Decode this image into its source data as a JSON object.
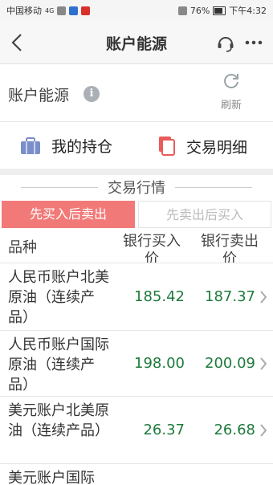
{
  "status_bar": {
    "carrier": "中国移动",
    "signal": "4G",
    "battery": "76%",
    "time": "下午4:32"
  },
  "header": {
    "title": "账户能源"
  },
  "account": {
    "label": "账户能源",
    "info_icon": "info-icon",
    "refresh_label": "刷新"
  },
  "quick_links": {
    "positions": "我的持仓",
    "history": "交易明细"
  },
  "market": {
    "section_title": "交易行情",
    "tabs": [
      "先买入后卖出",
      "先卖出后买入"
    ],
    "active_tab": 0,
    "columns": [
      "品种",
      "银行买入价",
      "银行卖出价"
    ],
    "rows": [
      {
        "name": "人民币账户北美原油（连续产品）",
        "buy": "185.42",
        "sell": "187.37"
      },
      {
        "name": "人民币账户国际原油（连续产品）",
        "buy": "198.00",
        "sell": "200.09"
      },
      {
        "name": "美元账户北美原油（连续产品）",
        "buy": "26.37",
        "sell": "26.68"
      },
      {
        "name": "美元账户国际",
        "buy": "",
        "sell": ""
      }
    ]
  },
  "colors": {
    "active_tab_bg": "#f17a78",
    "price_green": "#1e7a3c",
    "history_icon": "#e85c5c",
    "positions_icon": "#7a8ec9"
  }
}
